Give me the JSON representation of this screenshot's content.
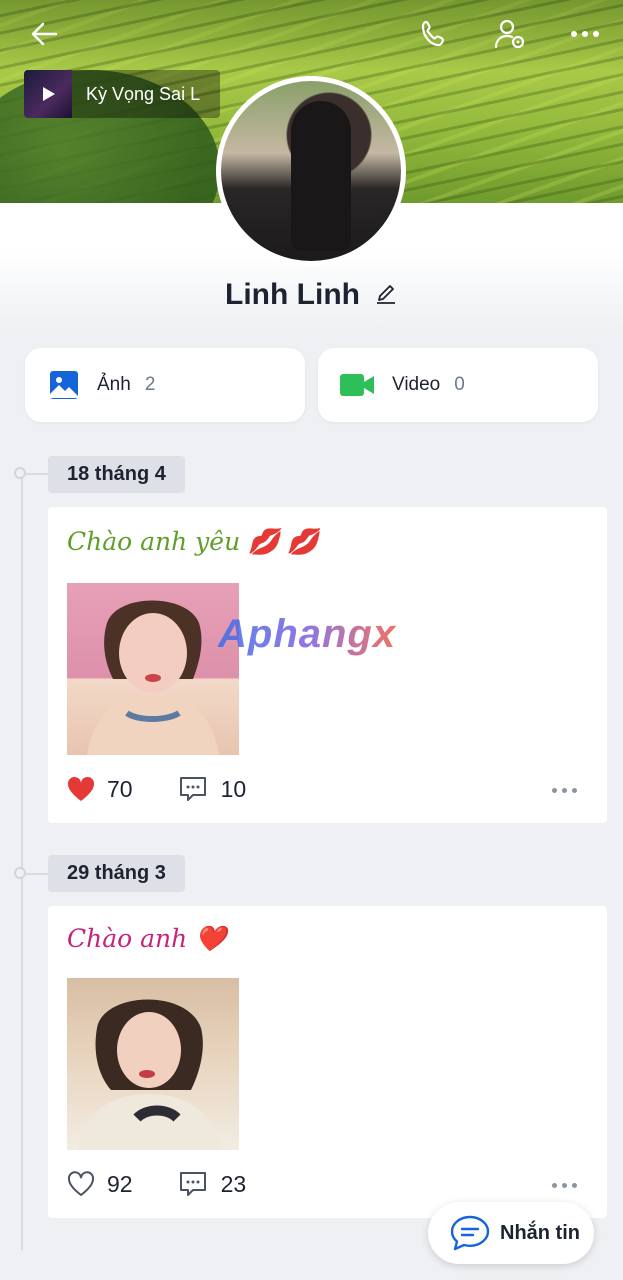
{
  "header": {
    "music_title": "Kỳ Vọng Sai L"
  },
  "profile": {
    "name": "Linh Linh"
  },
  "media": {
    "photos": {
      "label": "Ảnh",
      "count": "2"
    },
    "videos": {
      "label": "Video",
      "count": "0"
    }
  },
  "watermark": "Aphangx",
  "posts": [
    {
      "date": "18 tháng 4",
      "text": "Chào anh yêu 💋 💋",
      "text_color": "#5f9e2a",
      "likes": "70",
      "comments": "10",
      "liked": true
    },
    {
      "date": "29 tháng 3",
      "text": "Chào anh ❤️",
      "text_color": "#c8237a",
      "likes": "92",
      "comments": "23",
      "liked": false
    }
  ],
  "message_button": {
    "label": "Nhắn tin"
  },
  "colors": {
    "accent": "#1565d8",
    "heart": "#e53935",
    "video": "#2fbf59"
  }
}
